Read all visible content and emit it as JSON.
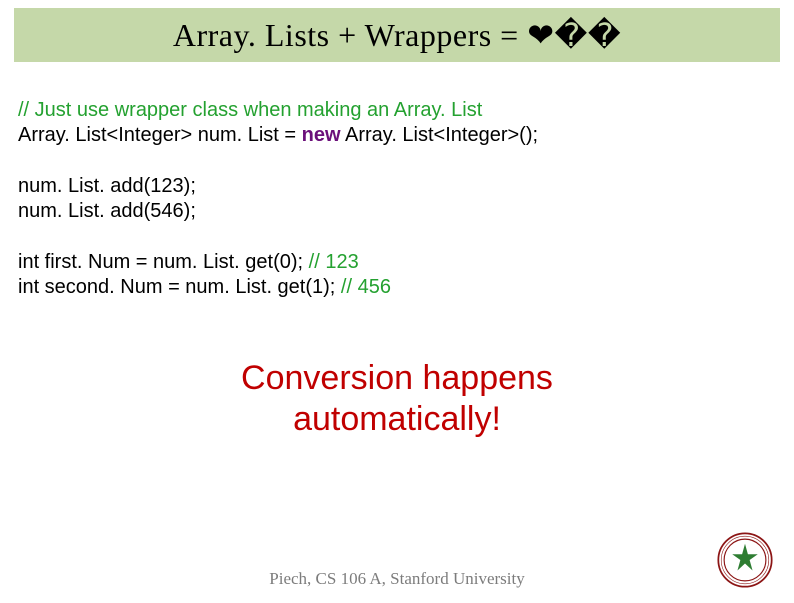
{
  "title": "Array. Lists + Wrappers = ❤��",
  "code": {
    "b1_comment": "// Just use wrapper class when making an Array. List",
    "b1_l2_pre": "Array. List<Integer> num. List = ",
    "b1_l2_kw": "new",
    "b1_l2_post": " Array. List<Integer>();",
    "b2_l1": "num. List. add(123);",
    "b2_l2": "num. List. add(546);",
    "b3_l1_code": "int first. Num = num. List. get(0);     ",
    "b3_l1_cm": "// 123",
    "b3_l2_code": "int second. Num = num. List. get(1); ",
    "b3_l2_cm": "// 456"
  },
  "callout_l1": "Conversion happens",
  "callout_l2": "automatically!",
  "footer": "Piech, CS 106 A, Stanford University"
}
